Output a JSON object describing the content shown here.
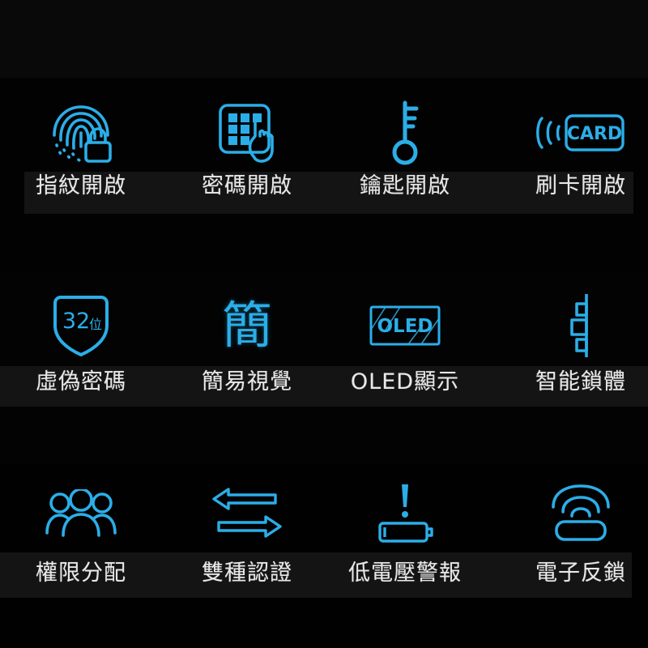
{
  "theme": {
    "background": "#000000",
    "accent": "#2BAEE8",
    "label_color": "#E8E8E8",
    "label_strip": "#141414"
  },
  "features": {
    "rows": [
      {
        "cells": [
          {
            "label": "指紋開啟",
            "icon": "fingerprint-lock-icon"
          },
          {
            "label": "密碼開啟",
            "icon": "keypad-touch-icon"
          },
          {
            "label": "鑰匙開啟",
            "icon": "key-icon"
          },
          {
            "label": "刷卡開啟",
            "icon": "card-swipe-icon",
            "icon_text": "CARD"
          }
        ]
      },
      {
        "cells": [
          {
            "label": "虛偽密碼",
            "icon": "shield-icon",
            "icon_text": "32",
            "icon_subtext": "位"
          },
          {
            "label": "簡易視覺",
            "icon": "simple-character-icon",
            "icon_text": "簡"
          },
          {
            "label": "OLED顯示",
            "icon": "oled-screen-icon",
            "icon_text": "OLED"
          },
          {
            "label": "智能鎖體",
            "icon": "lock-body-icon"
          }
        ]
      },
      {
        "cells": [
          {
            "label": "權限分配",
            "icon": "users-group-icon"
          },
          {
            "label": "雙種認證",
            "icon": "two-way-arrows-icon"
          },
          {
            "label": "低電壓警報",
            "icon": "low-battery-alert-icon"
          },
          {
            "label": "電子反鎖",
            "icon": "wireless-deadbolt-icon"
          }
        ]
      }
    ]
  }
}
